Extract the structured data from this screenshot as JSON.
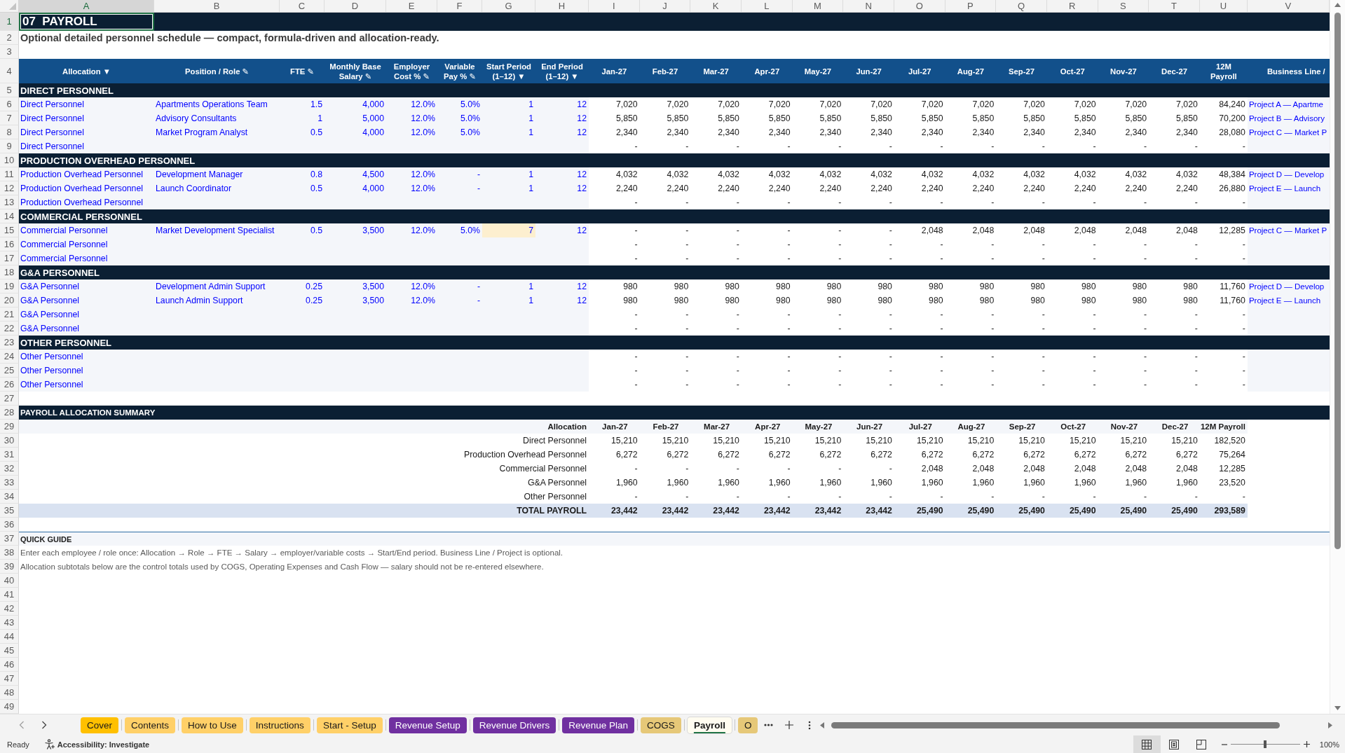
{
  "column_headers": [
    {
      "label": "A",
      "selected": true
    },
    {
      "label": "B",
      "selected": false
    },
    {
      "label": "C",
      "selected": false
    },
    {
      "label": "D",
      "selected": false
    },
    {
      "label": "E",
      "selected": false
    },
    {
      "label": "F",
      "selected": false
    },
    {
      "label": "G",
      "selected": false
    },
    {
      "label": "H",
      "selected": false
    },
    {
      "label": "I",
      "selected": false
    },
    {
      "label": "J",
      "selected": false
    },
    {
      "label": "K",
      "selected": false
    },
    {
      "label": "L",
      "selected": false
    },
    {
      "label": "M",
      "selected": false
    },
    {
      "label": "N",
      "selected": false
    },
    {
      "label": "O",
      "selected": false
    },
    {
      "label": "P",
      "selected": false
    },
    {
      "label": "Q",
      "selected": false
    },
    {
      "label": "R",
      "selected": false
    },
    {
      "label": "S",
      "selected": false
    },
    {
      "label": "T",
      "selected": false
    },
    {
      "label": "U",
      "selected": false
    },
    {
      "label": "V",
      "selected": false
    }
  ],
  "rows": [
    {
      "number": "1",
      "selected": true,
      "kind": "title",
      "text": "07  PAYROLL"
    },
    {
      "number": "2",
      "selected": false,
      "kind": "subtitle",
      "text": "Optional detailed personnel schedule — compact, formula-driven and allocation-ready."
    },
    {
      "number": "3",
      "selected": false,
      "kind": "blank"
    },
    {
      "number": "4",
      "selected": false,
      "kind": "header",
      "columns": [
        {
          "lines": [
            "Allocation ▼"
          ]
        },
        {
          "lines": [
            "Position / Role ✎"
          ]
        },
        {
          "lines": [
            "FTE ✎"
          ]
        },
        {
          "lines": [
            "Monthly Base",
            "Salary ✎"
          ]
        },
        {
          "lines": [
            "Employer",
            "Cost % ✎"
          ]
        },
        {
          "lines": [
            "Variable",
            "Pay % ✎"
          ]
        },
        {
          "lines": [
            "Start Period",
            "(1–12) ▼"
          ]
        },
        {
          "lines": [
            "End Period",
            "(1–12) ▼"
          ]
        },
        {
          "lines": [
            "Jan-27"
          ]
        },
        {
          "lines": [
            "Feb-27"
          ]
        },
        {
          "lines": [
            "Mar-27"
          ]
        },
        {
          "lines": [
            "Apr-27"
          ]
        },
        {
          "lines": [
            "May-27"
          ]
        },
        {
          "lines": [
            "Jun-27"
          ]
        },
        {
          "lines": [
            "Jul-27"
          ]
        },
        {
          "lines": [
            "Aug-27"
          ]
        },
        {
          "lines": [
            "Sep-27"
          ]
        },
        {
          "lines": [
            "Oct-27"
          ]
        },
        {
          "lines": [
            "Nov-27"
          ]
        },
        {
          "lines": [
            "Dec-27"
          ]
        },
        {
          "lines": [
            "12M",
            "Payroll"
          ]
        },
        {
          "lines": [
            "Business Line /"
          ]
        }
      ]
    },
    {
      "number": "5",
      "selected": false,
      "kind": "section",
      "text": "DIRECT PERSONNEL"
    },
    {
      "number": "6",
      "selected": false,
      "kind": "entry",
      "allocation": "Direct Personnel",
      "role": "Apartments Operations Team",
      "fte": "1.5",
      "salary": "4,000",
      "employer_cost": "12.0%",
      "variable_pay": "5.0%",
      "start_period": "1",
      "start_highlighted": false,
      "end_period": "12",
      "months": [
        "7,020",
        "7,020",
        "7,020",
        "7,020",
        "7,020",
        "7,020",
        "7,020",
        "7,020",
        "7,020",
        "7,020",
        "7,020",
        "7,020"
      ],
      "total": "84,240",
      "business_line": "Project A — Apartme"
    },
    {
      "number": "7",
      "selected": false,
      "kind": "entry",
      "allocation": "Direct Personnel",
      "role": "Advisory Consultants",
      "fte": "1",
      "salary": "5,000",
      "employer_cost": "12.0%",
      "variable_pay": "5.0%",
      "start_period": "1",
      "start_highlighted": false,
      "end_period": "12",
      "months": [
        "5,850",
        "5,850",
        "5,850",
        "5,850",
        "5,850",
        "5,850",
        "5,850",
        "5,850",
        "5,850",
        "5,850",
        "5,850",
        "5,850"
      ],
      "total": "70,200",
      "business_line": "Project B — Advisory"
    },
    {
      "number": "8",
      "selected": false,
      "kind": "entry",
      "allocation": "Direct Personnel",
      "role": "Market Program Analyst",
      "fte": "0.5",
      "salary": "4,000",
      "employer_cost": "12.0%",
      "variable_pay": "5.0%",
      "start_period": "1",
      "start_highlighted": false,
      "end_period": "12",
      "months": [
        "2,340",
        "2,340",
        "2,340",
        "2,340",
        "2,340",
        "2,340",
        "2,340",
        "2,340",
        "2,340",
        "2,340",
        "2,340",
        "2,340"
      ],
      "total": "28,080",
      "business_line": "Project C — Market P"
    },
    {
      "number": "9",
      "selected": false,
      "kind": "entry",
      "allocation": "Direct Personnel",
      "months": [
        "-",
        "-",
        "-",
        "-",
        "-",
        "-",
        "-",
        "-",
        "-",
        "-",
        "-",
        "-"
      ],
      "total": "-"
    },
    {
      "number": "10",
      "selected": false,
      "kind": "section",
      "text": "PRODUCTION OVERHEAD PERSONNEL"
    },
    {
      "number": "11",
      "selected": false,
      "kind": "entry",
      "allocation": "Production Overhead Personnel",
      "role": "Development Manager",
      "fte": "0.8",
      "salary": "4,500",
      "employer_cost": "12.0%",
      "variable_pay": "-",
      "start_period": "1",
      "start_highlighted": false,
      "end_period": "12",
      "months": [
        "4,032",
        "4,032",
        "4,032",
        "4,032",
        "4,032",
        "4,032",
        "4,032",
        "4,032",
        "4,032",
        "4,032",
        "4,032",
        "4,032"
      ],
      "total": "48,384",
      "business_line": "Project D — Develop"
    },
    {
      "number": "12",
      "selected": false,
      "kind": "entry",
      "allocation": "Production Overhead Personnel",
      "role": "Launch Coordinator",
      "fte": "0.5",
      "salary": "4,000",
      "employer_cost": "12.0%",
      "variable_pay": "-",
      "start_period": "1",
      "start_highlighted": false,
      "end_period": "12",
      "months": [
        "2,240",
        "2,240",
        "2,240",
        "2,240",
        "2,240",
        "2,240",
        "2,240",
        "2,240",
        "2,240",
        "2,240",
        "2,240",
        "2,240"
      ],
      "total": "26,880",
      "business_line": "Project E — Launch"
    },
    {
      "number": "13",
      "selected": false,
      "kind": "entry",
      "allocation": "Production Overhead Personnel",
      "months": [
        "-",
        "-",
        "-",
        "-",
        "-",
        "-",
        "-",
        "-",
        "-",
        "-",
        "-",
        "-"
      ],
      "total": "-"
    },
    {
      "number": "14",
      "selected": false,
      "kind": "section",
      "text": "COMMERCIAL PERSONNEL"
    },
    {
      "number": "15",
      "selected": false,
      "kind": "entry",
      "allocation": "Commercial Personnel",
      "role": "Market Development Specialist",
      "fte": "0.5",
      "salary": "3,500",
      "employer_cost": "12.0%",
      "variable_pay": "5.0%",
      "start_period": "7",
      "start_highlighted": true,
      "end_period": "12",
      "months": [
        "-",
        "-",
        "-",
        "-",
        "-",
        "-",
        "2,048",
        "2,048",
        "2,048",
        "2,048",
        "2,048",
        "2,048"
      ],
      "total": "12,285",
      "business_line": "Project C — Market P"
    },
    {
      "number": "16",
      "selected": false,
      "kind": "entry",
      "allocation": "Commercial Personnel",
      "months": [
        "-",
        "-",
        "-",
        "-",
        "-",
        "-",
        "-",
        "-",
        "-",
        "-",
        "-",
        "-"
      ],
      "total": "-"
    },
    {
      "number": "17",
      "selected": false,
      "kind": "entry",
      "allocation": "Commercial Personnel",
      "months": [
        "-",
        "-",
        "-",
        "-",
        "-",
        "-",
        "-",
        "-",
        "-",
        "-",
        "-",
        "-"
      ],
      "total": "-"
    },
    {
      "number": "18",
      "selected": false,
      "kind": "section",
      "text": "G&A PERSONNEL"
    },
    {
      "number": "19",
      "selected": false,
      "kind": "entry",
      "allocation": "G&A Personnel",
      "role": "Development Admin Support",
      "fte": "0.25",
      "salary": "3,500",
      "employer_cost": "12.0%",
      "variable_pay": "-",
      "start_period": "1",
      "start_highlighted": false,
      "end_period": "12",
      "months": [
        "980",
        "980",
        "980",
        "980",
        "980",
        "980",
        "980",
        "980",
        "980",
        "980",
        "980",
        "980"
      ],
      "total": "11,760",
      "business_line": "Project D — Develop"
    },
    {
      "number": "20",
      "selected": false,
      "kind": "entry",
      "allocation": "G&A Personnel",
      "role": "Launch Admin Support",
      "fte": "0.25",
      "salary": "3,500",
      "employer_cost": "12.0%",
      "variable_pay": "-",
      "start_period": "1",
      "start_highlighted": false,
      "end_period": "12",
      "months": [
        "980",
        "980",
        "980",
        "980",
        "980",
        "980",
        "980",
        "980",
        "980",
        "980",
        "980",
        "980"
      ],
      "total": "11,760",
      "business_line": "Project E — Launch"
    },
    {
      "number": "21",
      "selected": false,
      "kind": "entry",
      "allocation": "G&A Personnel",
      "months": [
        "-",
        "-",
        "-",
        "-",
        "-",
        "-",
        "-",
        "-",
        "-",
        "-",
        "-",
        "-"
      ],
      "total": "-"
    },
    {
      "number": "22",
      "selected": false,
      "kind": "entry",
      "allocation": "G&A Personnel",
      "months": [
        "-",
        "-",
        "-",
        "-",
        "-",
        "-",
        "-",
        "-",
        "-",
        "-",
        "-",
        "-"
      ],
      "total": "-"
    },
    {
      "number": "23",
      "selected": false,
      "kind": "section",
      "text": "OTHER PERSONNEL"
    },
    {
      "number": "24",
      "selected": false,
      "kind": "entry",
      "allocation": "Other Personnel",
      "months": [
        "-",
        "-",
        "-",
        "-",
        "-",
        "-",
        "-",
        "-",
        "-",
        "-",
        "-",
        "-"
      ],
      "total": "-"
    },
    {
      "number": "25",
      "selected": false,
      "kind": "entry",
      "allocation": "Other Personnel",
      "months": [
        "-",
        "-",
        "-",
        "-",
        "-",
        "-",
        "-",
        "-",
        "-",
        "-",
        "-",
        "-"
      ],
      "total": "-"
    },
    {
      "number": "26",
      "selected": false,
      "kind": "entry",
      "allocation": "Other Personnel",
      "months": [
        "-",
        "-",
        "-",
        "-",
        "-",
        "-",
        "-",
        "-",
        "-",
        "-",
        "-",
        "-"
      ],
      "total": "-"
    },
    {
      "number": "27",
      "selected": false,
      "kind": "blank"
    },
    {
      "number": "28",
      "selected": false,
      "kind": "summary_section",
      "text": "PAYROLL ALLOCATION SUMMARY"
    },
    {
      "number": "29",
      "selected": false,
      "kind": "summary_header",
      "label": "Allocation",
      "months": [
        "Jan-27",
        "Feb-27",
        "Mar-27",
        "Apr-27",
        "May-27",
        "Jun-27",
        "Jul-27",
        "Aug-27",
        "Sep-27",
        "Oct-27",
        "Nov-27",
        "Dec-27"
      ],
      "total": "12M Payroll"
    },
    {
      "number": "30",
      "selected": false,
      "kind": "summary",
      "label": "Direct Personnel",
      "months": [
        "15,210",
        "15,210",
        "15,210",
        "15,210",
        "15,210",
        "15,210",
        "15,210",
        "15,210",
        "15,210",
        "15,210",
        "15,210",
        "15,210"
      ],
      "total": "182,520"
    },
    {
      "number": "31",
      "selected": false,
      "kind": "summary",
      "label": "Production Overhead Personnel",
      "months": [
        "6,272",
        "6,272",
        "6,272",
        "6,272",
        "6,272",
        "6,272",
        "6,272",
        "6,272",
        "6,272",
        "6,272",
        "6,272",
        "6,272"
      ],
      "total": "75,264"
    },
    {
      "number": "32",
      "selected": false,
      "kind": "summary",
      "label": "Commercial Personnel",
      "months": [
        "-",
        "-",
        "-",
        "-",
        "-",
        "-",
        "2,048",
        "2,048",
        "2,048",
        "2,048",
        "2,048",
        "2,048"
      ],
      "total": "12,285"
    },
    {
      "number": "33",
      "selected": false,
      "kind": "summary",
      "label": "G&A Personnel",
      "months": [
        "1,960",
        "1,960",
        "1,960",
        "1,960",
        "1,960",
        "1,960",
        "1,960",
        "1,960",
        "1,960",
        "1,960",
        "1,960",
        "1,960"
      ],
      "total": "23,520"
    },
    {
      "number": "34",
      "selected": false,
      "kind": "summary",
      "label": "Other Personnel",
      "months": [
        "-",
        "-",
        "-",
        "-",
        "-",
        "-",
        "-",
        "-",
        "-",
        "-",
        "-",
        "-"
      ],
      "total": "-"
    },
    {
      "number": "35",
      "selected": false,
      "kind": "summary_total",
      "label": "TOTAL PAYROLL",
      "months": [
        "23,442",
        "23,442",
        "23,442",
        "23,442",
        "23,442",
        "23,442",
        "25,490",
        "25,490",
        "25,490",
        "25,490",
        "25,490",
        "25,490"
      ],
      "total": "293,589"
    },
    {
      "number": "36",
      "selected": false,
      "kind": "blank"
    },
    {
      "number": "37",
      "selected": false,
      "kind": "guide_heading",
      "text": "QUICK GUIDE"
    },
    {
      "number": "38",
      "selected": false,
      "kind": "guide_text",
      "text": "Enter each employee / role once: Allocation → Role → FTE → Salary → employer/variable costs → Start/End period. Business Line / Project is optional."
    },
    {
      "number": "39",
      "selected": false,
      "kind": "guide_text",
      "text": "Allocation subtotals below are the control totals used by COGS, Operating Expenses and Cash Flow — salary should not be re-entered elsewhere."
    },
    {
      "number": "40",
      "selected": false,
      "kind": "blank"
    },
    {
      "number": "41",
      "selected": false,
      "kind": "blank"
    },
    {
      "number": "42",
      "selected": false,
      "kind": "blank"
    },
    {
      "number": "43",
      "selected": false,
      "kind": "blank"
    },
    {
      "number": "44",
      "selected": false,
      "kind": "blank"
    },
    {
      "number": "45",
      "selected": false,
      "kind": "blank"
    },
    {
      "number": "46",
      "selected": false,
      "kind": "blank"
    },
    {
      "number": "47",
      "selected": false,
      "kind": "blank"
    },
    {
      "number": "48",
      "selected": false,
      "kind": "blank"
    },
    {
      "number": "49",
      "selected": false,
      "kind": "blank"
    }
  ],
  "sheet_tabs": [
    {
      "label": "Cover",
      "color": "#ffc000",
      "selected": false
    },
    {
      "label": "Contents",
      "color": "#ffd068",
      "selected": false
    },
    {
      "label": "How to Use",
      "color": "#ffd068",
      "selected": false
    },
    {
      "label": "Instructions",
      "color": "#ffd068",
      "selected": false
    },
    {
      "label": "Start - Setup",
      "color": "#ffd068",
      "selected": false
    },
    {
      "label": "Revenue Setup",
      "color": "#7030a0",
      "selected": false
    },
    {
      "label": "Revenue Drivers",
      "color": "#7030a0",
      "selected": false
    },
    {
      "label": "Revenue Plan",
      "color": "#7030a0",
      "selected": false
    },
    {
      "label": "COGS",
      "color": "#e6c878",
      "selected": false
    },
    {
      "label": "Payroll",
      "selected": true
    },
    {
      "label": "O",
      "color": "#e6c878",
      "selected": false
    }
  ],
  "status_bar": {
    "status": "Ready",
    "accessibility": "Accessibility: Investigate",
    "views": [
      {
        "kind": "normal",
        "selected": true
      },
      {
        "kind": "page_layout",
        "selected": false
      },
      {
        "kind": "page_break",
        "selected": false
      }
    ],
    "zoom": {
      "level": 0.5,
      "reading": "100%"
    }
  }
}
